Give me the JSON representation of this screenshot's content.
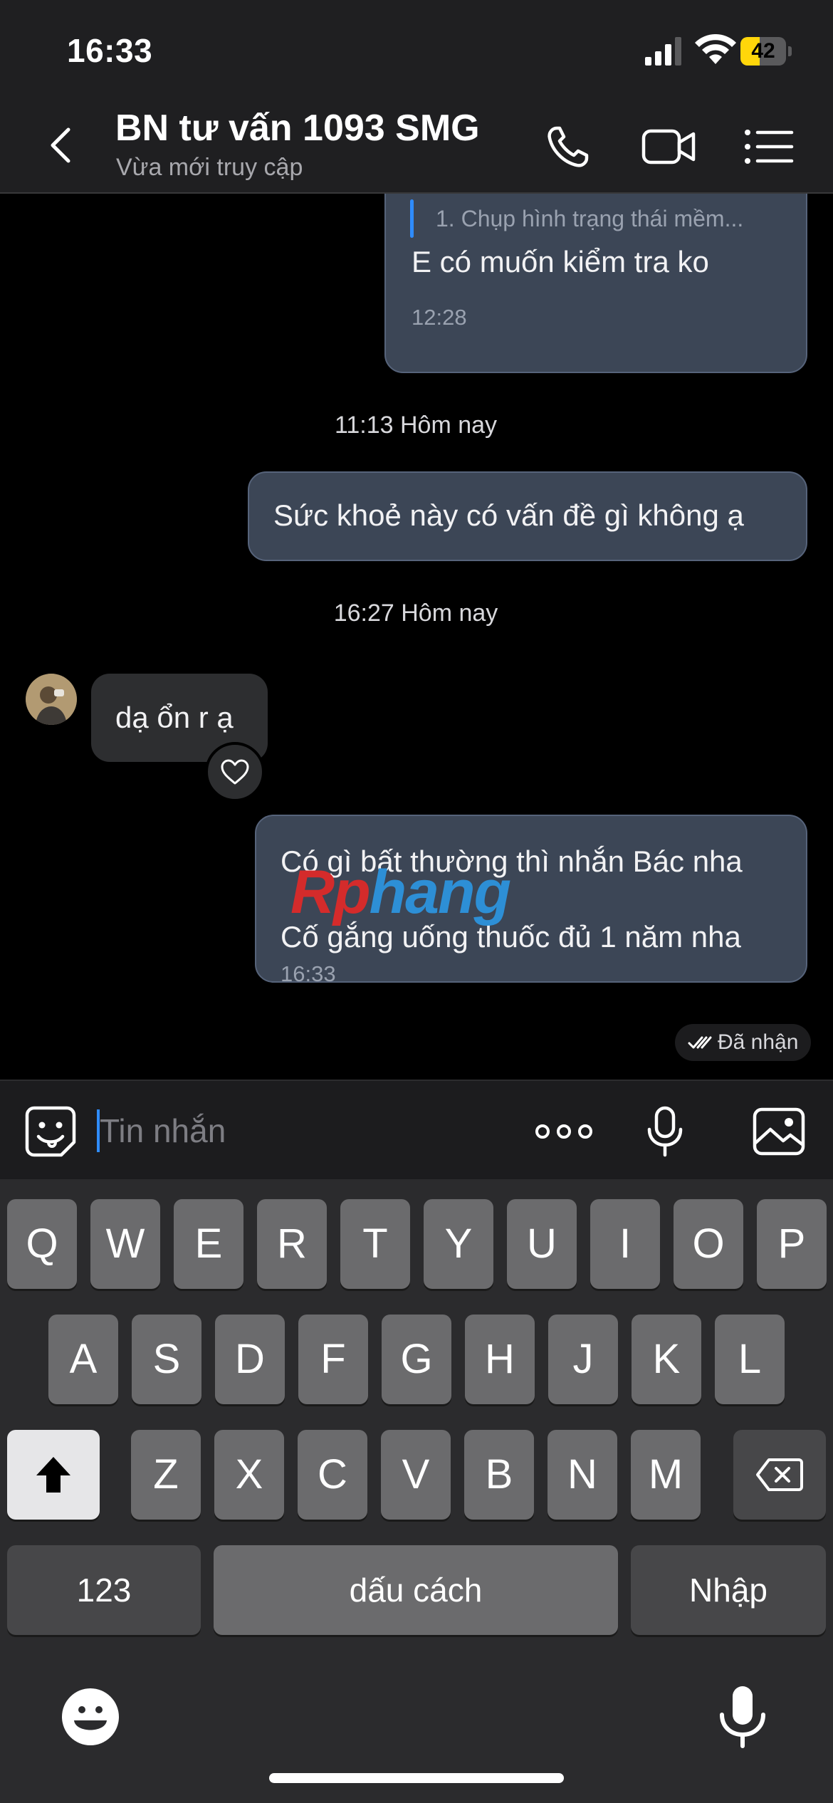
{
  "status_bar": {
    "time": "16:33",
    "battery": "42",
    "battery_level": 0.42
  },
  "header": {
    "title": "BN tư vấn 1093 SMG",
    "subtitle": "Vừa mới truy cập"
  },
  "messages": {
    "m1_quote": "1. Chụp hình trạng thái mềm...",
    "m1_text": "E có muốn kiểm tra ko",
    "m1_time": "12:28",
    "sep1": "11:13 Hôm nay",
    "m2_text": "Sức khoẻ này có vấn đề gì không ạ",
    "sep2": "16:27 Hôm nay",
    "m3_text": "dạ ổn r ạ",
    "m4_line1": "Có gì bất thường thì nhắn Bác nha",
    "m4_line2": "Cố gắng uống thuốc đủ 1 năm nha",
    "m4_time": "16:33",
    "status": "Đã nhận"
  },
  "watermark": {
    "part1": "Rp",
    "part2": "hang"
  },
  "input": {
    "placeholder": "Tin nhắn",
    "more_label": "ooo"
  },
  "keyboard": {
    "row1": [
      "Q",
      "W",
      "E",
      "R",
      "T",
      "Y",
      "U",
      "I",
      "O",
      "P"
    ],
    "row2": [
      "A",
      "S",
      "D",
      "F",
      "G",
      "H",
      "J",
      "K",
      "L"
    ],
    "row3": [
      "Z",
      "X",
      "C",
      "V",
      "B",
      "N",
      "M"
    ],
    "numbers_label": "123",
    "space_label": "dấu cách",
    "enter_label": "Nhập"
  },
  "colors": {
    "accent": "#2f8cff",
    "outgoing_bubble": "#3c4656",
    "incoming_bubble": "#2d2e30",
    "battery_fill": "#ffd60a"
  },
  "icons": [
    "back-chevron-icon",
    "phone-icon",
    "video-camera-icon",
    "menu-list-icon",
    "sticker-icon",
    "more-icon",
    "microphone-icon",
    "image-icon",
    "heart-icon",
    "double-check-icon",
    "shift-icon",
    "backspace-icon",
    "emoji-icon",
    "dictation-mic-icon"
  ]
}
